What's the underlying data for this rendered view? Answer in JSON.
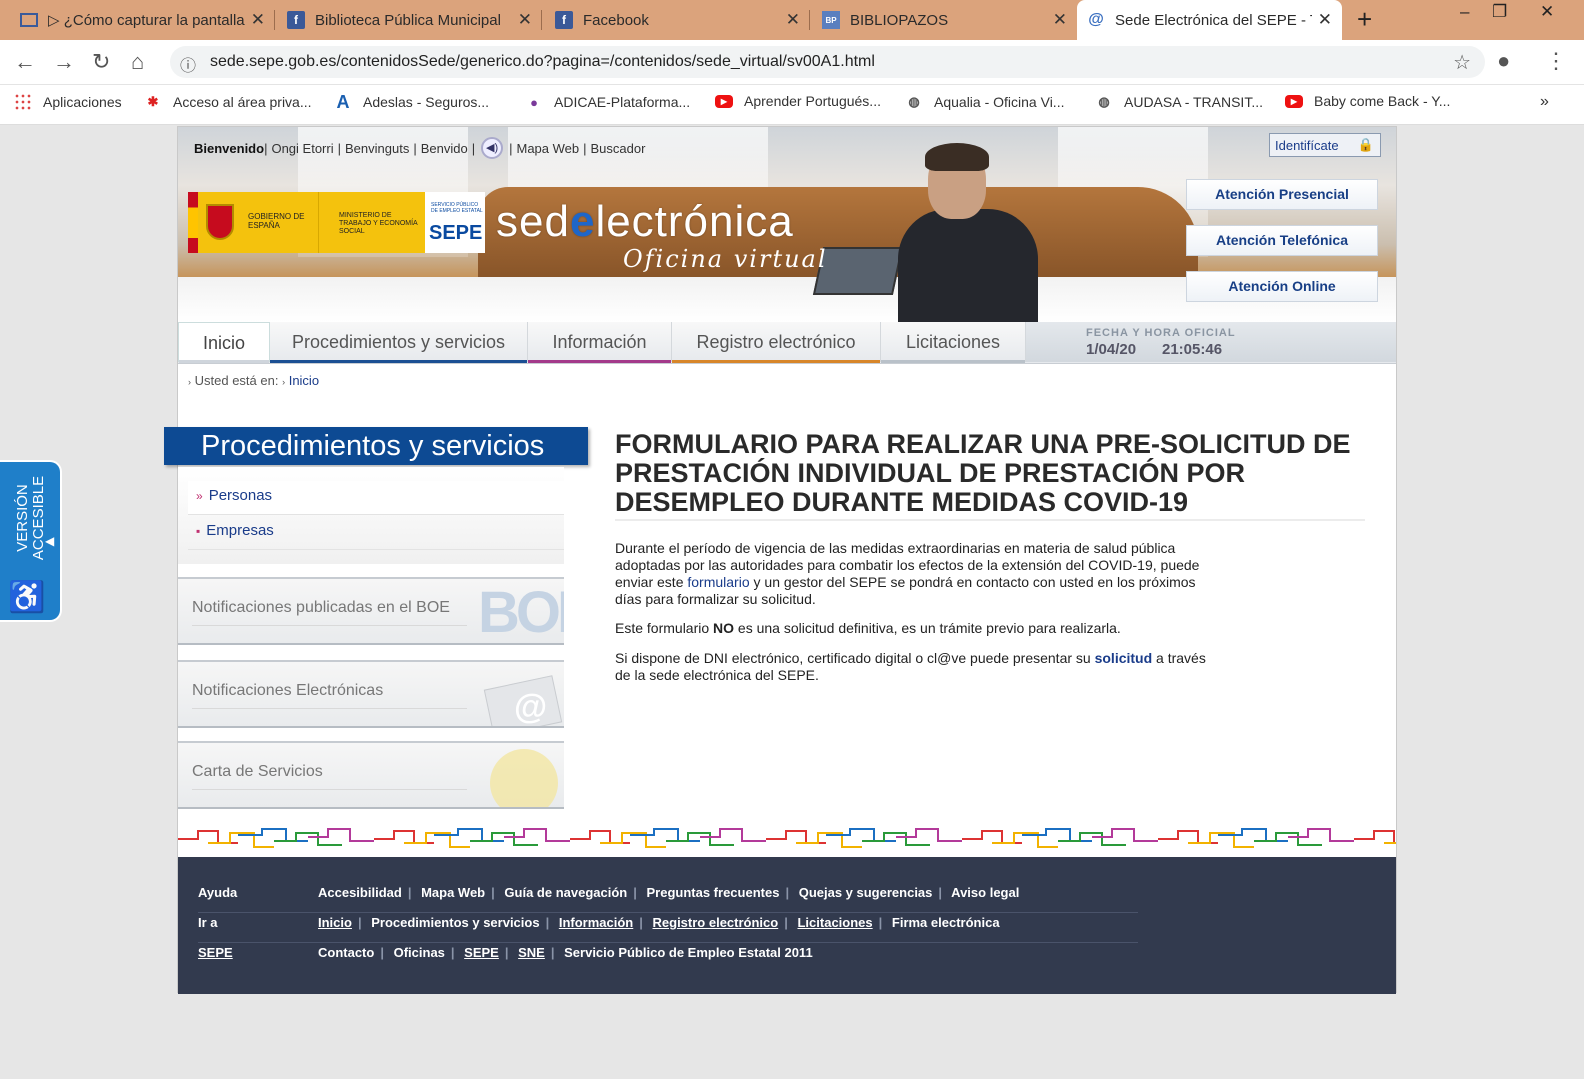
{
  "browser": {
    "tabs": [
      {
        "label": "▷ ¿Cómo capturar la pantalla",
        "icon": "screen-capture-icon"
      },
      {
        "label": "Biblioteca Pública Municipal",
        "icon": "facebook-icon"
      },
      {
        "label": "Facebook",
        "icon": "facebook-icon"
      },
      {
        "label": "BIBLIOPAZOS",
        "icon": "bibliopazos-icon"
      },
      {
        "label": "Sede Electrónica del SEPE - T",
        "icon": "at-sign-icon"
      }
    ],
    "url": "sede.sepe.gob.es/contenidosSede/generico.do?pagina=/contenidos/sede_virtual/sv00A1.html",
    "bookmarks": [
      {
        "label": "Aplicaciones",
        "icon": "apps-grid-icon"
      },
      {
        "label": "Acceso al área priva...",
        "icon": "red-logo-icon"
      },
      {
        "label": "Adeslas - Seguros...",
        "icon": "adeslas-a-icon"
      },
      {
        "label": "ADICAE-Plataforma...",
        "icon": "adicae-icon"
      },
      {
        "label": "Aprender Portugués...",
        "icon": "youtube-icon"
      },
      {
        "label": "Aqualia - Oficina Vi...",
        "icon": "globe-icon"
      },
      {
        "label": "AUDASA - TRANSIT...",
        "icon": "globe-icon"
      },
      {
        "label": "Baby come Back - Y...",
        "icon": "youtube-icon"
      }
    ],
    "bookmarks_more": "»",
    "colors": {
      "tabbar": "#dba37c",
      "active_tab": "#ffffff"
    }
  },
  "header": {
    "welcome": "Bienvenido",
    "languages": [
      "Ongi Etorri",
      "Benvinguts",
      "Benvido"
    ],
    "links": [
      "Mapa Web",
      "Buscador"
    ],
    "login": "Identifícate",
    "gov_logo_text": "GOBIERNO DE ESPAÑA",
    "ministry_text": "MINISTERIO DE TRABAJO Y ECONOMÍA SOCIAL",
    "sepe_small": "SERVICIO PÚBLICO DE EMPLEO ESTATAL",
    "sepe_logo": "SEPE",
    "site_title_before": "sed",
    "site_title_e": "e",
    "site_title_after": "lectrónica",
    "site_subtitle": "Oficina virtual",
    "attention_buttons": [
      "Atención Presencial",
      "Atención Telefónica",
      "Atención Online"
    ]
  },
  "nav": {
    "tabs": [
      {
        "label": "Inicio",
        "accent": "#cfd5dc"
      },
      {
        "label": "Procedimientos y servicios",
        "accent": "#1b4f93"
      },
      {
        "label": "Información",
        "accent": "#a33a8a"
      },
      {
        "label": "Registro electrónico",
        "accent": "#d7862a"
      },
      {
        "label": "Licitaciones",
        "accent": "#b9c1c9"
      }
    ],
    "official_label": "FECHA Y HORA OFICIAL",
    "date": "1/04/20",
    "time": "21:05:46"
  },
  "breadcrumb": {
    "prefix": "Usted está en:",
    "link": "Inicio"
  },
  "sidebar": {
    "heading": "Procedimientos y servicios",
    "items": [
      "Personas",
      "Empresas"
    ],
    "item_markers": [
      "»",
      "▪"
    ],
    "panels": [
      {
        "label_before": "Notificaciones publicadas en el ",
        "label_link": "BOE",
        "deco": "BOE"
      },
      {
        "label_before": "Notificaciones Electrónicas",
        "label_link": "",
        "deco": "@"
      },
      {
        "label_before": "Carta de Servicios",
        "label_link": "",
        "deco": ""
      }
    ]
  },
  "main": {
    "title": "FORMULARIO PARA REALIZAR UNA PRE-SOLICITUD DE PRESTACIÓN INDIVIDUAL DE PRESTACIÓN POR DESEMPLEO DURANTE MEDIDAS COVID-19",
    "p1_before": "Durante el período de vigencia de las medidas extraordinarias en materia de salud pública adoptadas por las autoridades para combatir los efectos de la extensión del COVID-19, puede enviar este ",
    "p1_link": "formulario",
    "p1_after": " y un gestor del SEPE se pondrá en contacto con usted en los próximos días para formalizar su solicitud.",
    "p2_before": "Este formulario ",
    "p2_bold": "NO",
    "p2_after": " es una solicitud definitiva, es un trámite previo para realizarla.",
    "p3_before": "Si dispone de DNI electrónico, certificado digital o cl@ve puede presentar su ",
    "p3_link": "solicitud",
    "p3_after": " a través de la sede electrónica del SEPE."
  },
  "footer": {
    "rows": [
      {
        "heading": "Ayuda",
        "heading_link": false,
        "links": [
          "Accesibilidad",
          "Mapa Web",
          "Guía de navegación",
          "Preguntas frecuentes",
          "Quejas y sugerencias",
          "Aviso legal"
        ],
        "underlined": []
      },
      {
        "heading": "Ir a",
        "heading_link": false,
        "links": [
          "Inicio",
          "Procedimientos y servicios",
          "Información",
          "Registro electrónico",
          "Licitaciones",
          "Firma electrónica"
        ],
        "underlined": [
          0,
          2,
          3,
          4
        ]
      },
      {
        "heading": "SEPE",
        "heading_link": true,
        "links": [
          "Contacto",
          "Oficinas",
          "SEPE",
          "SNE",
          "Servicio Público de Empleo Estatal 2011"
        ],
        "underlined": [
          2,
          3
        ]
      }
    ],
    "bg": "#323a4e"
  },
  "accessible_tab": {
    "line1": "VERSIÓN",
    "line2": "ACCESIBLE"
  }
}
